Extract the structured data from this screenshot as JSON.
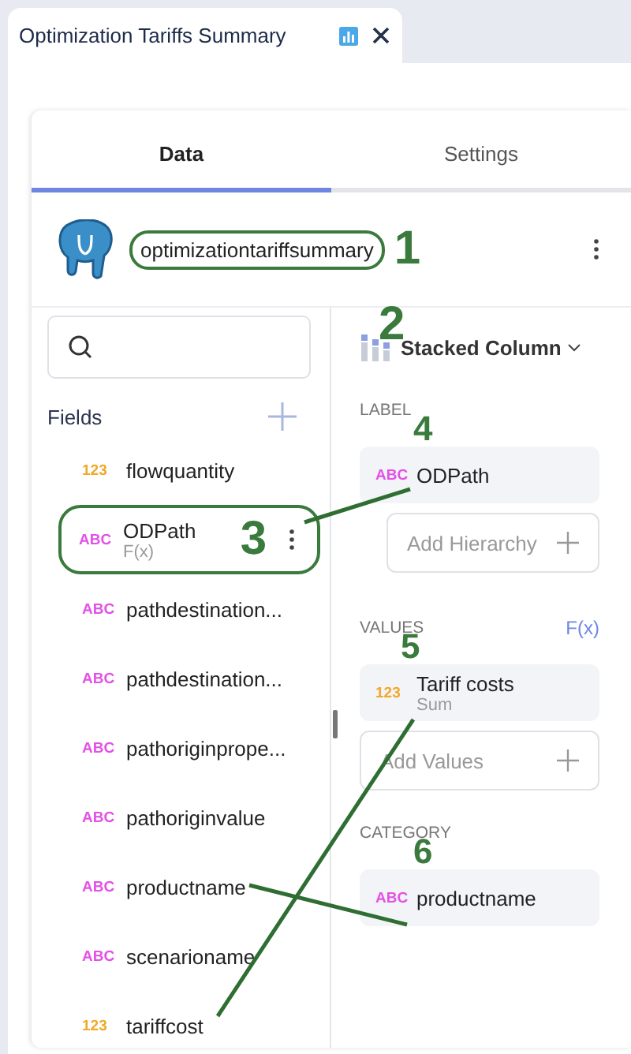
{
  "tab": {
    "title": "Optimization Tariffs Summary"
  },
  "panel_tabs": [
    {
      "label": "Data",
      "selected": true
    },
    {
      "label": "Settings",
      "selected": false
    }
  ],
  "dataset": {
    "name": "optimizationtariffsummary",
    "outlined": true,
    "callout": "1"
  },
  "fields_header": {
    "label": "Fields"
  },
  "fields": [
    {
      "kind": "number",
      "badge": "123",
      "name": "flowquantity",
      "outlined": false,
      "menu": false
    },
    {
      "kind": "text",
      "badge": "ABC",
      "name": "ODPath",
      "subtitle": "F(x)",
      "outlined": true,
      "callout": "3",
      "menu": true
    },
    {
      "kind": "text",
      "badge": "ABC",
      "name": "pathdestination...",
      "outlined": false,
      "menu": false
    },
    {
      "kind": "text",
      "badge": "ABC",
      "name": "pathdestination...",
      "outlined": false,
      "menu": false
    },
    {
      "kind": "text",
      "badge": "ABC",
      "name": "pathoriginprope...",
      "outlined": false,
      "menu": false
    },
    {
      "kind": "text",
      "badge": "ABC",
      "name": "pathoriginvalue",
      "outlined": false,
      "menu": false
    },
    {
      "kind": "text",
      "badge": "ABC",
      "name": "productname",
      "outlined": false,
      "menu": false
    },
    {
      "kind": "text",
      "badge": "ABC",
      "name": "scenarioname",
      "outlined": false,
      "menu": false
    },
    {
      "kind": "number",
      "badge": "123",
      "name": "tariffcost",
      "outlined": false,
      "menu": false
    }
  ],
  "chart_type": {
    "label": "Stacked Column",
    "callout": "2"
  },
  "sections": [
    {
      "title": "LABEL",
      "items": [
        {
          "kind": "text",
          "badge": "ABC",
          "name": "ODPath",
          "callout": "4"
        }
      ],
      "add": {
        "label": "Add Hierarchy",
        "indented": true
      }
    },
    {
      "title": "VALUES",
      "action": "F(x)",
      "items": [
        {
          "kind": "number",
          "badge": "123",
          "name": "Tariff costs",
          "subtitle": "Sum",
          "callout": "5"
        }
      ],
      "add": {
        "label": "Add Values",
        "indented": false
      }
    },
    {
      "title": "CATEGORY",
      "items": [
        {
          "kind": "text",
          "badge": "ABC",
          "name": "productname",
          "callout": "6"
        }
      ]
    }
  ]
}
